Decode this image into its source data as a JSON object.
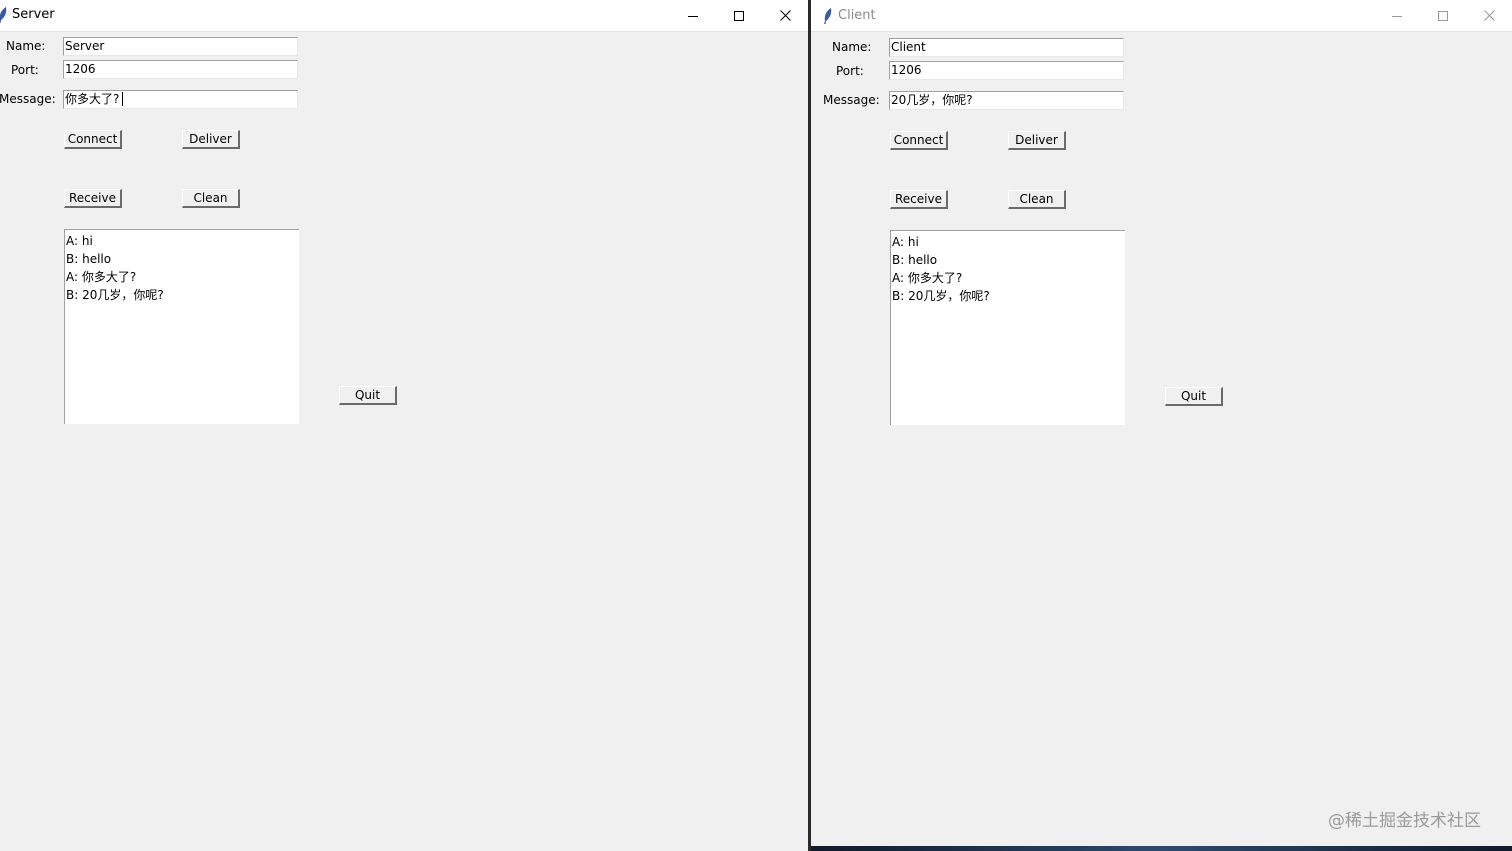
{
  "server": {
    "title": "Server",
    "name_label": "Name:",
    "name_value": "Server",
    "port_label": "Port:",
    "port_value": "1206",
    "message_label": "Message:",
    "message_value": "你多大了?",
    "buttons": {
      "connect": "Connect",
      "deliver": "Deliver",
      "receive": "Receive",
      "clean": "Clean",
      "quit": "Quit"
    },
    "log": [
      "A: hi",
      "B: hello",
      "A: 你多大了?",
      "B: 20几岁，你呢?"
    ]
  },
  "client": {
    "title": "Client",
    "name_label": "Name:",
    "name_value": "Client",
    "port_label": "Port:",
    "port_value": "1206",
    "message_label": "Message:",
    "message_value": "20几岁，你呢?",
    "buttons": {
      "connect": "Connect",
      "deliver": "Deliver",
      "receive": "Receive",
      "clean": "Clean",
      "quit": "Quit"
    },
    "log": [
      "A: hi",
      "B: hello",
      "A: 你多大了?",
      "B: 20几岁，你呢?"
    ]
  },
  "watermark": "@稀土掘金技术社区",
  "icons": {
    "app": "feather-icon",
    "minimize": "minimize-icon",
    "maximize": "maximize-icon",
    "close": "close-icon"
  }
}
